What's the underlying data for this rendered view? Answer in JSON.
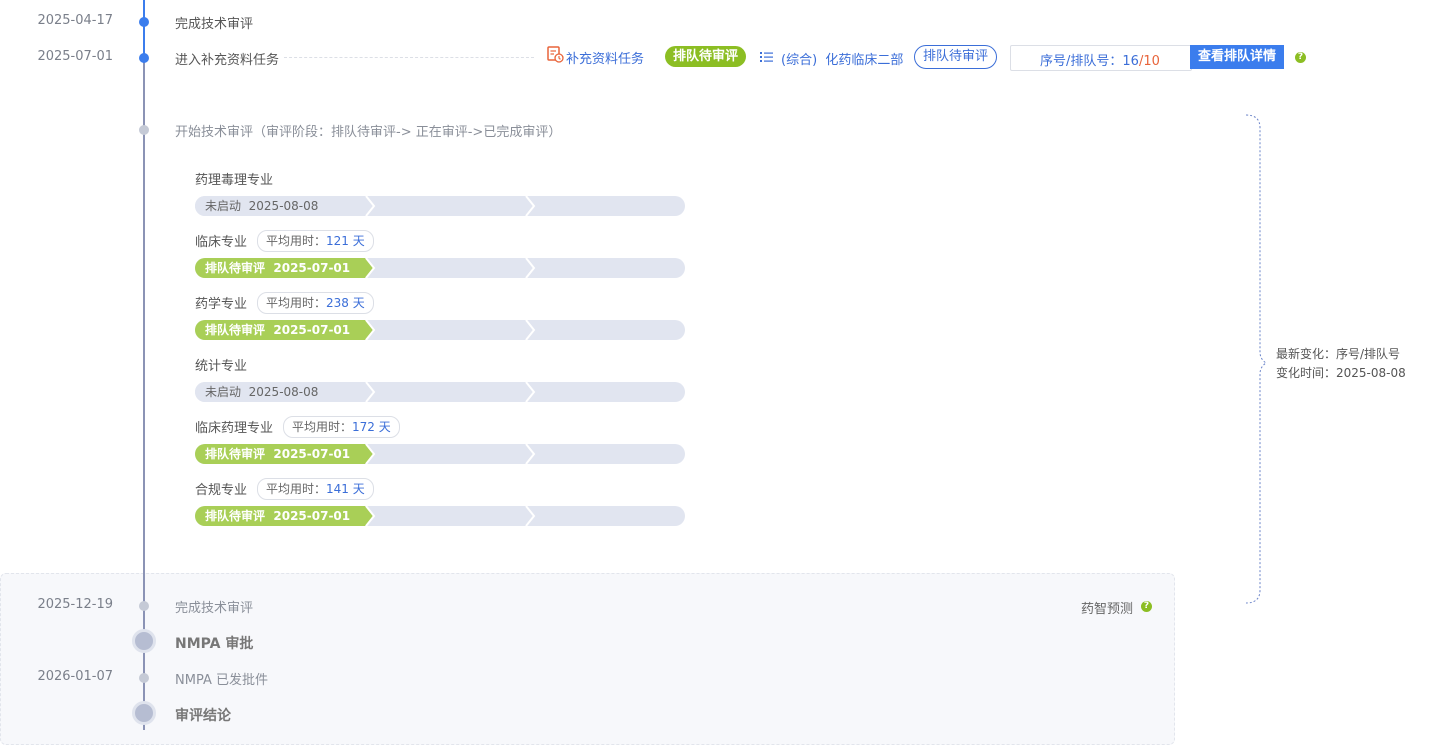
{
  "timeline": {
    "ev1": {
      "date": "2025-04-17",
      "label": "完成技术审评"
    },
    "ev2": {
      "date": "2025-07-01",
      "label": "进入补充资料任务"
    },
    "ev3": {
      "label": "开始技术审评",
      "stages": "（审评阶段：排队待审评-> 正在审评->已完成审评）"
    }
  },
  "task_bar": {
    "supplement_link": "补充资料任务",
    "status_badge": "排队待审评",
    "dept_prefix": "(综合)",
    "dept_name": "化药临床二部",
    "status_outline": "排队待审评",
    "queue_label": "序号/排队号：",
    "queue_current": "16",
    "queue_sep": "/",
    "queue_total": "10",
    "queue_button": "查看排队详情",
    "help_glyph": "?"
  },
  "avg_label": "平均用时：",
  "specialties": [
    {
      "name": "药理毒理专业",
      "avg": "",
      "status": "未启动",
      "date": "2025-08-08",
      "active": false
    },
    {
      "name": "临床专业",
      "avg": "121 天",
      "status": "排队待审评",
      "date": "2025-07-01",
      "active": true
    },
    {
      "name": "药学专业",
      "avg": "238 天",
      "status": "排队待审评",
      "date": "2025-07-01",
      "active": true
    },
    {
      "name": "统计专业",
      "avg": "",
      "status": "未启动",
      "date": "2025-08-08",
      "active": false
    },
    {
      "name": "临床药理专业",
      "avg": "172 天",
      "status": "排队待审评",
      "date": "2025-07-01",
      "active": true
    },
    {
      "name": "合规专业",
      "avg": "141 天",
      "status": "排队待审评",
      "date": "2025-07-01",
      "active": true
    }
  ],
  "change_note": {
    "line1": "最新变化：序号/排队号",
    "line2": "变化时间：2025-08-08"
  },
  "prediction": {
    "label": "药智预测",
    "help_glyph": "?",
    "ev1": {
      "date": "2025-12-19",
      "label": "完成技术审评"
    },
    "phase1": "NMPA 审批",
    "ev2": {
      "date": "2026-01-07",
      "label": "NMPA 已发批件"
    },
    "phase2": "审评结论"
  },
  "colors": {
    "accent": "#3b7ded",
    "green": "#8cbe23",
    "bar_green": "#a9cf57",
    "bar_grey": "#e1e5f0",
    "queue_total": "#e8643a"
  }
}
